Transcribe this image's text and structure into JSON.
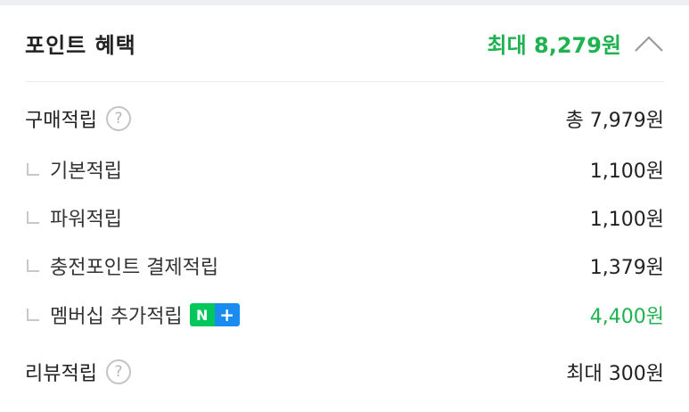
{
  "colors": {
    "accent_green": "#1fb250",
    "badge_green": "#03c75a",
    "badge_blue": "#1a8cf0"
  },
  "header": {
    "title": "포인트 혜택",
    "max_amount": "최대 8,279원",
    "collapse_icon": "chevron-up-icon"
  },
  "purchase": {
    "label": "구매적립",
    "help_icon": "question-circle-icon",
    "help_glyph": "?",
    "total": "총 7,979원",
    "items": [
      {
        "label": "기본적립",
        "value": "1,100원",
        "highlight": false
      },
      {
        "label": "파워적립",
        "value": "1,100원",
        "highlight": false
      },
      {
        "label": "충전포인트 결제적립",
        "value": "1,379원",
        "highlight": false
      },
      {
        "label": "멤버십 추가적립",
        "value": "4,400원",
        "highlight": true,
        "badge_letter": "N",
        "badge_plus": "+"
      }
    ]
  },
  "review": {
    "label": "리뷰적립",
    "help_icon": "question-circle-icon",
    "help_glyph": "?",
    "value": "최대 300원"
  }
}
